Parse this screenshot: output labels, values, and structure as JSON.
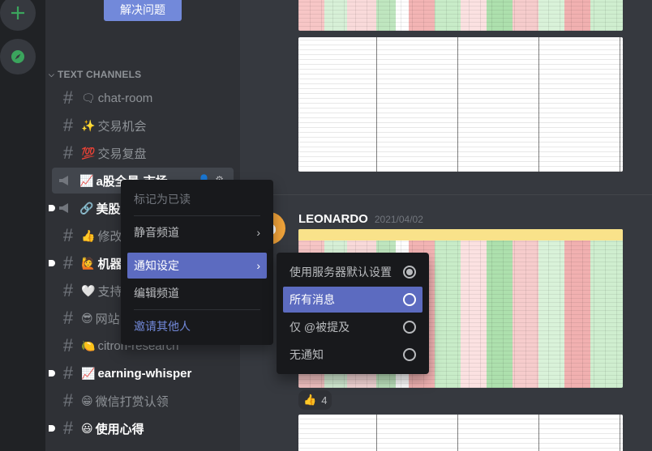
{
  "sidebar": {
    "solve_button": "解决问题",
    "category": "TEXT CHANNELS",
    "channels": [
      {
        "emoji": "🗨",
        "name": "chat-room"
      },
      {
        "emoji": "✨",
        "name": "交易机会"
      },
      {
        "emoji": "💯",
        "name": "交易复盘"
      },
      {
        "emoji": "📈",
        "name": "a股全景-市场"
      },
      {
        "emoji": "🔗",
        "name": "美股i"
      },
      {
        "emoji": "👍",
        "name": "修改"
      },
      {
        "emoji": "🙋",
        "name": "机器"
      },
      {
        "emoji": "🤍",
        "name": "支持"
      },
      {
        "emoji": "😎",
        "name": "网站"
      },
      {
        "emoji": "🍋",
        "name": "citron-research"
      },
      {
        "emoji": "📈",
        "name": "earning-whisper"
      },
      {
        "emoji": "😁",
        "name": "微信打赏认领"
      },
      {
        "emoji": "😃",
        "name": "使用心得"
      }
    ]
  },
  "message": {
    "author": "LEONARDO",
    "timestamp": "2021/04/02",
    "reaction_emoji": "👍",
    "reaction_count": "4"
  },
  "context_menu": {
    "mark_read": "标记为已读",
    "mute": "静音频道",
    "notifications": "通知设定",
    "edit": "编辑频道",
    "invite": "邀请其他人"
  },
  "notify_submenu": {
    "server_default": "使用服务器默认设置",
    "all": "所有消息",
    "mentions": "仅 @被提及",
    "none": "无通知"
  },
  "colors": {
    "accent": "#7289da",
    "active": "#5c6bc0",
    "online": "#3ba55d"
  }
}
